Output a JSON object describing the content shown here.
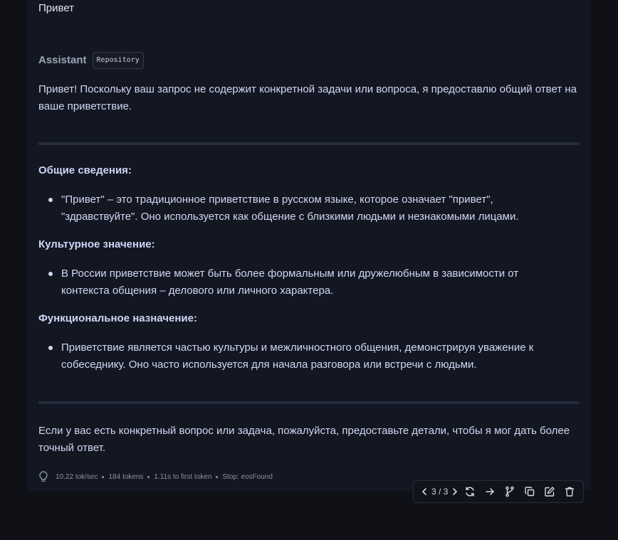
{
  "user_message": "Привет",
  "assistant": {
    "label": "Assistant",
    "badge": "Repository"
  },
  "message": {
    "intro": "Привет! Поскольку ваш запрос не содержит конкретной задачи или вопроса, я предоставлю общий ответ на ваше приветствие.",
    "sections": [
      {
        "heading": "Общие сведения:",
        "bullet": "\"Привет\" – это традиционное приветствие в русском языке, которое означает \"привет\", \"здравствуйте\". Оно используется как общение с близкими людьми и незнакомыми лицами."
      },
      {
        "heading": "Культурное значение:",
        "bullet": "В России приветствие может быть более формальным или дружелюбным в зависимости от контекста общения – делового или личного характера."
      },
      {
        "heading": "Функциональное назначение:",
        "bullet": "Приветствие является частью культуры и межличностного общения, демонстрируя уважение к собеседнику. Оно часто используется для начала разговора или встречи с людьми."
      }
    ],
    "closing": "Если у вас есть конкретный вопрос или задача, пожалуйста, предоставьте детали, чтобы я мог дать более точный ответ."
  },
  "stats": {
    "speed": "10.22 tok/sec",
    "tokens": "184 tokens",
    "first_token": "1.11s to first token",
    "stop": "Stop: eosFound"
  },
  "toolbar": {
    "page_indicator": "3 / 3",
    "icons": [
      "chevron-left-icon",
      "chevron-right-icon",
      "regenerate-icon",
      "continue-icon",
      "branch-icon",
      "copy-icon",
      "edit-icon",
      "delete-icon"
    ]
  }
}
